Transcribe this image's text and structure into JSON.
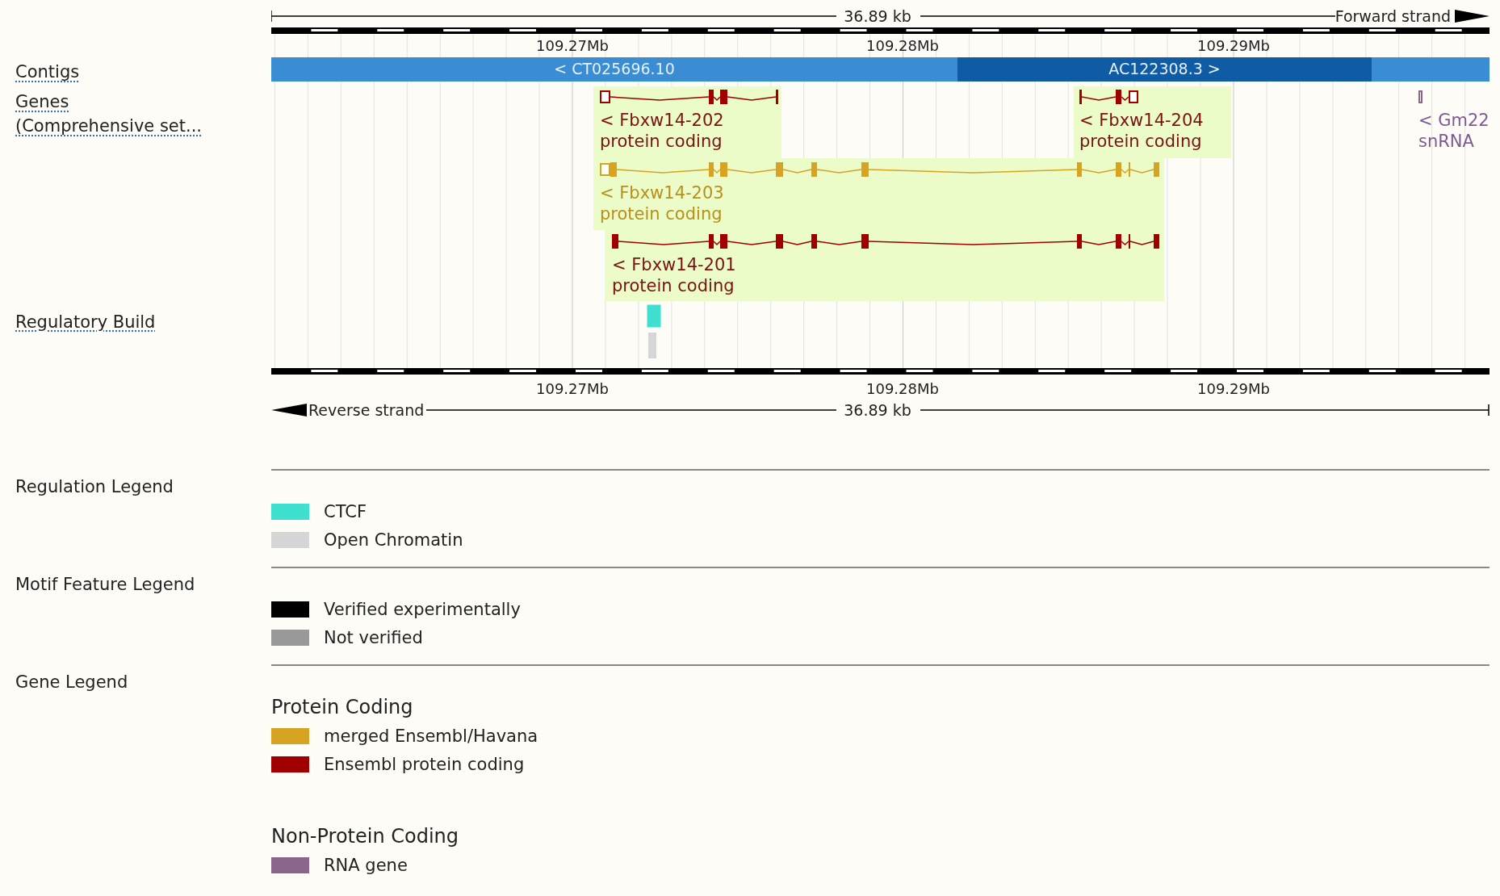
{
  "scale_top": {
    "length": "36.89 kb",
    "strand": "Forward strand"
  },
  "ticks_top": [
    "109.27Mb",
    "109.28Mb",
    "109.29Mb"
  ],
  "tracks": [
    {
      "label": "Contigs",
      "kind": "contigs"
    },
    {
      "label": "Genes\n(Comprehensive set...",
      "kind": "genes"
    },
    {
      "label": "Regulatory Build",
      "kind": "regulation"
    }
  ],
  "contigs": [
    {
      "label": "< CT025696.10",
      "color": "#3a8dd3"
    },
    {
      "label": "AC122308.3 >",
      "color": "#0f5ca4"
    }
  ],
  "genes": [
    {
      "name": "< Fbxw14-202",
      "biotype": "protein coding",
      "kind": "ensembl",
      "highlighted": true
    },
    {
      "name": "< Fbxw14-204",
      "biotype": "protein coding",
      "kind": "ensembl",
      "highlighted": true
    },
    {
      "name": "< Gm22",
      "biotype": "snRNA",
      "kind": "rna",
      "highlighted": false
    },
    {
      "name": "< Fbxw14-203",
      "biotype": "protein coding",
      "kind": "merged",
      "highlighted": true
    },
    {
      "name": "< Fbxw14-201",
      "biotype": "protein coding",
      "kind": "ensembl",
      "highlighted": true
    }
  ],
  "ticks_bottom": [
    "109.27Mb",
    "109.28Mb",
    "109.29Mb"
  ],
  "scale_bottom": {
    "length": "36.89 kb",
    "strand": "Reverse strand"
  },
  "legends": [
    {
      "title": "Regulation Legend",
      "groups": [
        {
          "items": [
            {
              "label": "CTCF",
              "color": "#40e0d0"
            },
            {
              "label": "Open Chromatin",
              "color": "#d6d6d6"
            }
          ]
        }
      ]
    },
    {
      "title": "Motif Feature Legend",
      "groups": [
        {
          "items": [
            {
              "label": "Verified experimentally",
              "color": "#000000"
            },
            {
              "label": "Not verified",
              "color": "#999999"
            }
          ]
        }
      ]
    },
    {
      "title": "Gene Legend",
      "groups": [
        {
          "title": "Protein Coding",
          "items": [
            {
              "label": "merged Ensembl/Havana",
              "color": "#d7a323"
            },
            {
              "label": "Ensembl protein coding",
              "color": "#a00000"
            }
          ]
        },
        {
          "title": "Non-Protein Coding",
          "items": [
            {
              "label": "RNA gene",
              "color": "#8b668b"
            }
          ]
        }
      ]
    }
  ]
}
